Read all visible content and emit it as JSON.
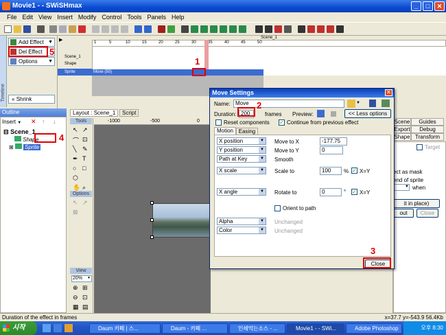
{
  "window": {
    "title": "Movie1 - - SWiSHmax"
  },
  "menu": [
    "File",
    "Edit",
    "View",
    "Insert",
    "Modify",
    "Control",
    "Tools",
    "Panels",
    "Help"
  ],
  "effects_panel": {
    "add_effect": "Add Effect",
    "del_effect": "Del Effect",
    "options": "Options",
    "shrink": "Shrink",
    "vtab": "Timeline"
  },
  "timeline": {
    "scene_label": "Scene_1",
    "rows": [
      "Scene_1",
      "Shape",
      "Sprite"
    ],
    "ruler_ticks": [
      "1",
      "5",
      "10",
      "15",
      "20",
      "25",
      "30",
      "35",
      "40",
      "45",
      "50"
    ],
    "move_bar": "Move (50)"
  },
  "outline": {
    "header": "Outline",
    "insert": "Insert",
    "scene": "Scene_1",
    "shape": "Shape",
    "sprite": "Sprite"
  },
  "layout": {
    "tab_layout": "Layout : Scene_1",
    "tab_script": "Script",
    "tools_header": "Tools",
    "options_header": "Options",
    "view_header": "View",
    "zoom": "20%",
    "ruler": [
      "-1000",
      "-500",
      "0"
    ]
  },
  "right_panel": {
    "tabs": [
      "Scene",
      "Guides",
      "Export",
      "Debug",
      "Shape",
      "Transform"
    ],
    "target": "Target",
    "mask1": "ect as mask",
    "mask2": "end of sprite",
    "when": "when",
    "in_place": "it in place)",
    "about": "out",
    "close": "Close"
  },
  "dialog": {
    "title": "Move Settings",
    "name_label": "Name:",
    "name_value": "Move",
    "duration_label": "Duration:",
    "duration_value": "200",
    "frames_label": "frames",
    "preview_label": "Preview:",
    "less_options": "<< Less options",
    "reset_components": "Reset components",
    "continue_prev": "Continue from previous effect",
    "tab_motion": "Motion",
    "tab_easing": "Easing",
    "rows": [
      {
        "dropdown": "X position",
        "label": "Move to X",
        "value": "-177.75"
      },
      {
        "dropdown": "Y position",
        "label": "Move to Y",
        "value": "0"
      },
      {
        "dropdown": "Path at Key",
        "label": "Smooth",
        "value": ""
      },
      {
        "dropdown": "X scale",
        "label": "Scale to",
        "value": "100",
        "unit": "%",
        "lock": "X=Y"
      },
      {
        "dropdown": "X angle",
        "label": "Rotate to",
        "value": "0",
        "unit": "°",
        "lock": "X=Y"
      }
    ],
    "orient_to_path": "Orient to path",
    "alpha": "Alpha",
    "color": "Color",
    "unchanged": "Unchanged",
    "close": "Close"
  },
  "annotations": [
    "1",
    "2",
    "3",
    "4",
    "5"
  ],
  "status": {
    "message": "Duration of the effect in frames",
    "coords": "x=37.7 y=-543.9  56.4Kb"
  },
  "taskbar": {
    "start": "시작",
    "tasks": [
      "Daum 카페 | 스...",
      "Daum - 카페 ...",
      "인쇄막는소스 - ...",
      "Movie1 - - SWi...",
      "Adobe Photoshop"
    ],
    "clock": "오후 8:30"
  }
}
